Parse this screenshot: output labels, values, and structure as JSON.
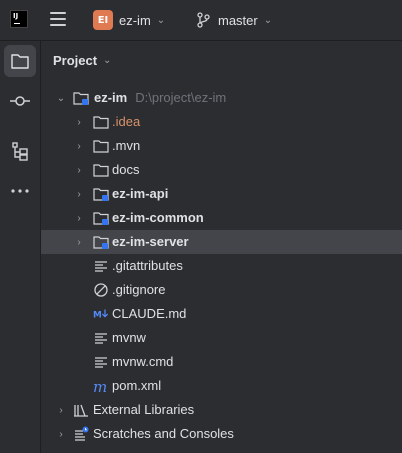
{
  "titlebar": {
    "logo_text": "IJ",
    "project_badge": "EI",
    "project_name": "ez-im",
    "branch_name": "master"
  },
  "toolstrip": {
    "items": [
      "project-tool",
      "commit-tool",
      "structure-tool",
      "more-tools"
    ]
  },
  "panel": {
    "title": "Project"
  },
  "tree": {
    "root": {
      "name": "ez-im",
      "path": "D:\\project\\ez-im"
    },
    "items": [
      {
        "name": ".idea",
        "kind": "folder",
        "style": "orange"
      },
      {
        "name": ".mvn",
        "kind": "folder",
        "style": "normal"
      },
      {
        "name": "docs",
        "kind": "folder",
        "style": "normal"
      },
      {
        "name": "ez-im-api",
        "kind": "module",
        "style": "bold"
      },
      {
        "name": "ez-im-common",
        "kind": "module",
        "style": "bold"
      },
      {
        "name": "ez-im-server",
        "kind": "module",
        "style": "bold",
        "selected": true
      },
      {
        "name": ".gitattributes",
        "kind": "text-file"
      },
      {
        "name": ".gitignore",
        "kind": "ignore-file"
      },
      {
        "name": "CLAUDE.md",
        "kind": "markdown-file"
      },
      {
        "name": "mvnw",
        "kind": "text-file"
      },
      {
        "name": "mvnw.cmd",
        "kind": "text-file"
      },
      {
        "name": "pom.xml",
        "kind": "maven-file"
      }
    ],
    "external_libraries": "External Libraries",
    "scratches": "Scratches and Consoles"
  },
  "colors": {
    "background": "#2b2d30",
    "selected_row": "#43454a",
    "accent_blue": "#3574f0",
    "orange_folder_text": "#d9926b",
    "badge": "#e07a52"
  }
}
